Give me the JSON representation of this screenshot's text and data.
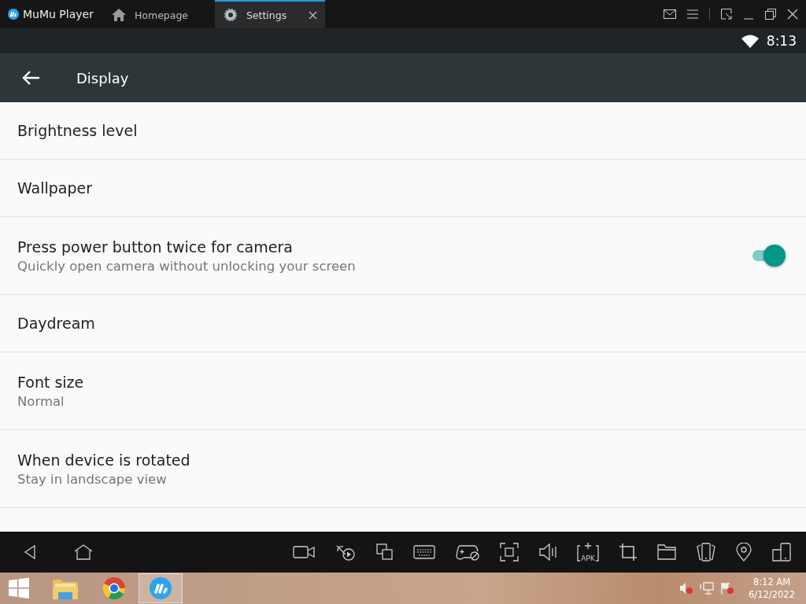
{
  "window": {
    "title": "MuMu Player"
  },
  "tabs": [
    {
      "label": "Homepage",
      "selected": false
    },
    {
      "label": "Settings",
      "selected": true
    }
  ],
  "status_bar": {
    "time": "8:13"
  },
  "app_bar": {
    "title": "Display"
  },
  "settings": [
    {
      "kind": "plain",
      "title": "Brightness level"
    },
    {
      "kind": "plain",
      "title": "Wallpaper"
    },
    {
      "kind": "switch",
      "title": "Press power button twice for camera",
      "summary": "Quickly open camera without unlocking your screen",
      "on": true
    },
    {
      "kind": "plain",
      "title": "Daydream"
    },
    {
      "kind": "plain",
      "title": "Font size",
      "summary": "Normal"
    },
    {
      "kind": "plain",
      "title": "When device is rotated",
      "summary": "Stay in landscape view"
    }
  ],
  "toolbar": {
    "apk_label": "APK"
  },
  "taskbar": {
    "time": "8:12 AM",
    "date": "6/12/2022"
  }
}
